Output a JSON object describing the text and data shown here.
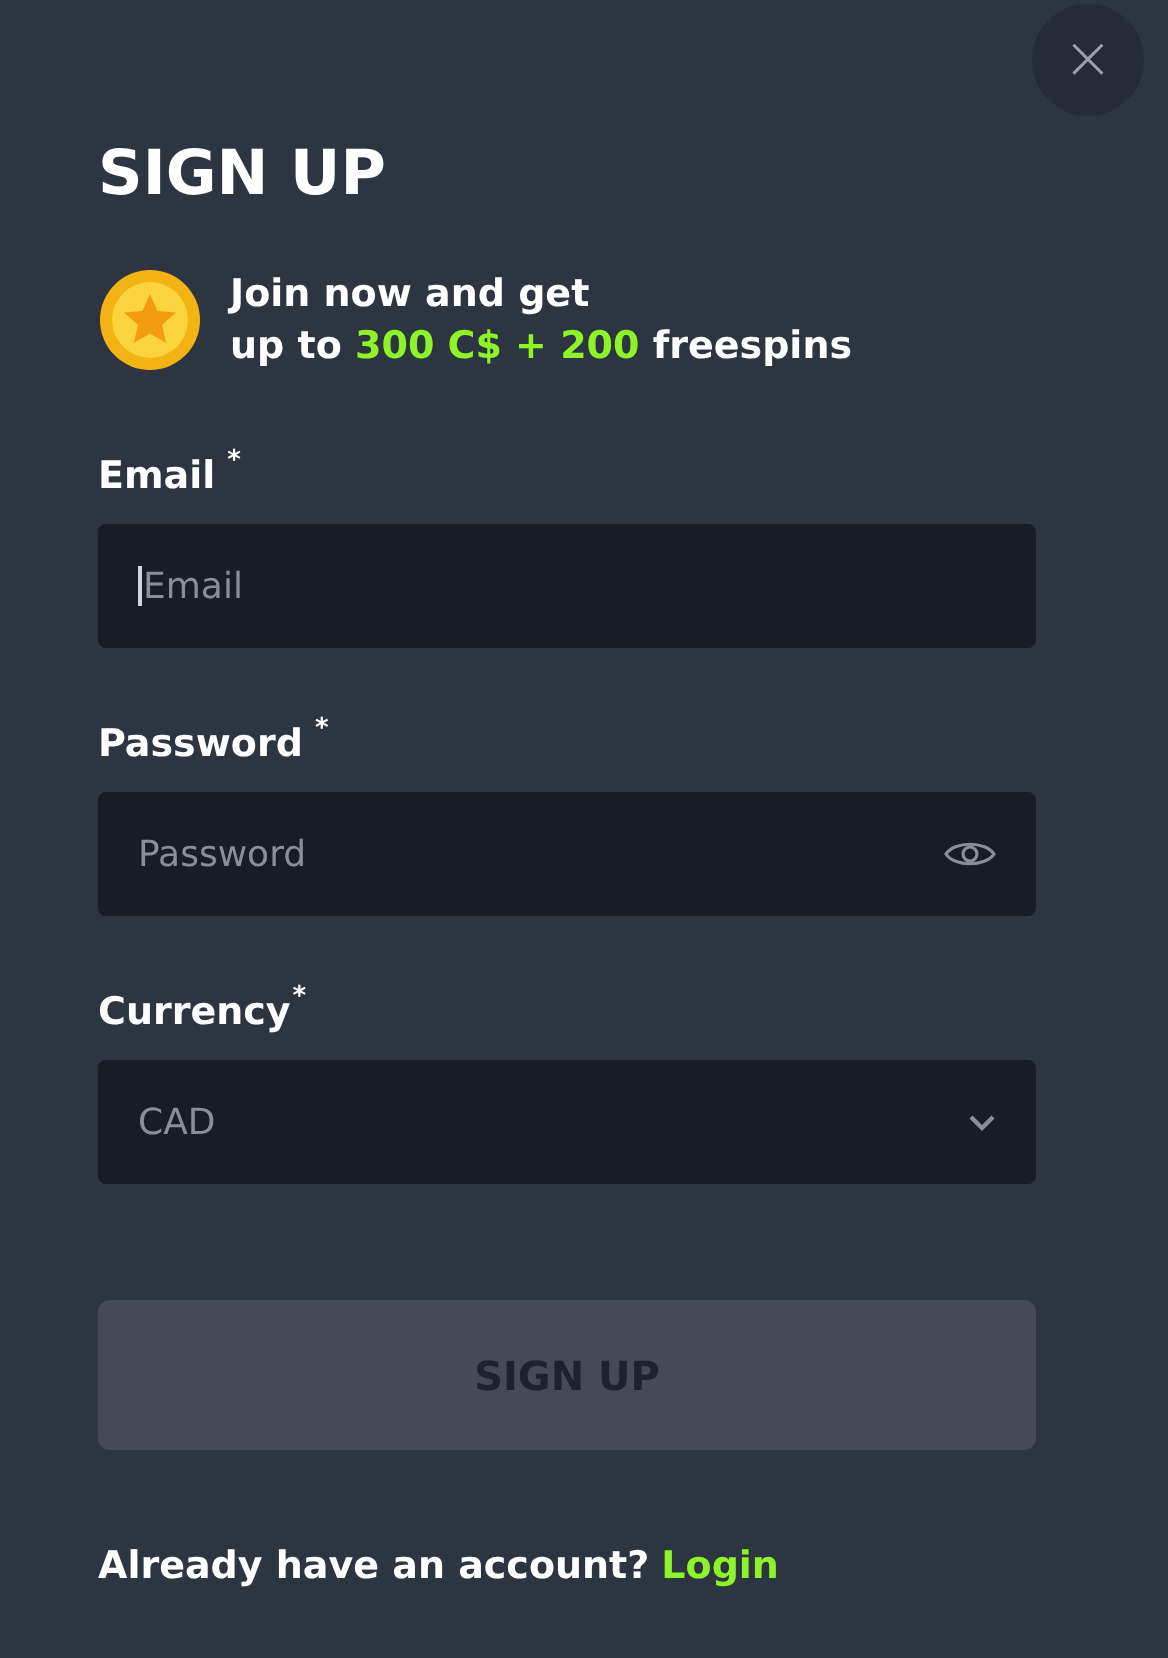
{
  "close_button": {
    "label": "×"
  },
  "title": "SIGN UP",
  "promo": {
    "lines": [
      [
        {
          "text": "Join now and get",
          "highlight": false
        }
      ],
      [
        {
          "text": "up to ",
          "highlight": false
        },
        {
          "text": "300 C$ + 200",
          "highlight": true
        },
        {
          "text": " freespins",
          "highlight": false
        }
      ]
    ]
  },
  "fields": [
    {
      "kind": "text",
      "label": "Email",
      "required_mark": "*",
      "placeholder": "Email",
      "focused": true
    },
    {
      "kind": "password",
      "label": "Password",
      "required_mark": "*",
      "placeholder": "Password",
      "focused": false
    },
    {
      "kind": "select",
      "label": "Currency",
      "required_mark": "*",
      "value": "CAD",
      "focused": false
    }
  ],
  "submit": {
    "label": "SIGN UP",
    "disabled": true
  },
  "footer": {
    "text": "Already have an account?",
    "link": "Login"
  }
}
